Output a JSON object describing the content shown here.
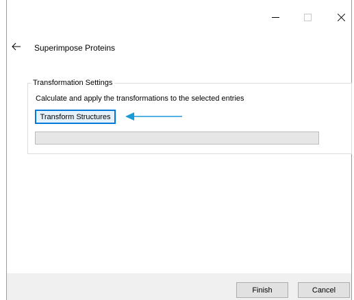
{
  "titlebar": {
    "minimize_icon": "minimize-icon",
    "maximize_icon": "maximize-icon",
    "close_icon": "close-icon"
  },
  "header": {
    "back_icon": "back-arrow-icon",
    "title": "Superimpose Proteins"
  },
  "transformation_settings": {
    "legend": "Transformation Settings",
    "description": "Calculate and apply the transformations to the selected entries",
    "transform_button_label": "Transform Structures",
    "annotation_arrow_color": "#1a9ad6",
    "progress": 0
  },
  "footer": {
    "finish_label": "Finish",
    "cancel_label": "Cancel"
  },
  "colors": {
    "focus_border": "#0078d7",
    "footer_background": "#f0f0f0",
    "progress_track": "#e6e6e6"
  }
}
